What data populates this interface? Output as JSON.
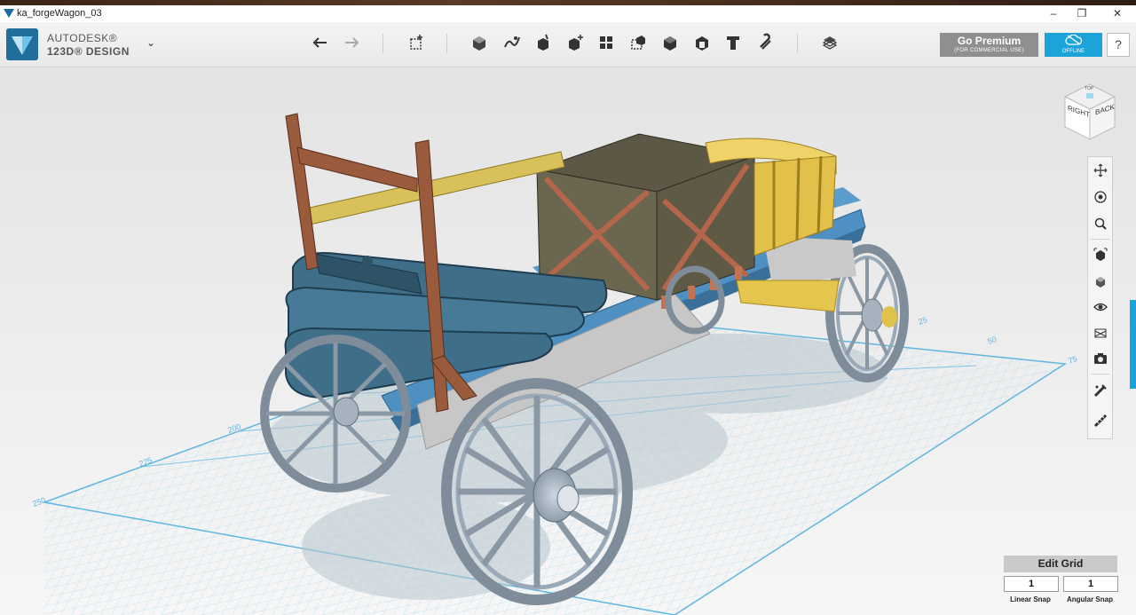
{
  "window": {
    "title": "ka_forgeWagon_03",
    "controls": [
      "minimize-icon",
      "maximize-icon",
      "close-icon"
    ]
  },
  "brand": {
    "line1": "AUTODESK®",
    "line2": "123D® DESIGN"
  },
  "toolbar": {
    "tools": [
      "undo-icon",
      "redo-icon",
      "primitives-icon",
      "sketch-icon",
      "construct-icon",
      "modify-icon",
      "pattern-icon",
      "grouping-icon",
      "combine-icon",
      "measure-icon",
      "text-icon",
      "snap-icon",
      "material-icon"
    ],
    "premium_label": "Go Premium",
    "premium_sub": "(FOR COMMERCIAL USE)",
    "offline_label": "OFFLINE",
    "help_label": "?"
  },
  "viewcube": {
    "face_right": "RIGHT",
    "face_back": "BACK",
    "face_top": "TOP"
  },
  "grid": {
    "labels": [
      "250",
      "225",
      "200",
      "25",
      "50",
      "75"
    ]
  },
  "navbar": {
    "items": [
      "pan-icon",
      "orbit-icon",
      "zoom-icon",
      "fit-icon",
      "view-icon",
      "visibility-icon",
      "material-view-icon",
      "camera-icon",
      "snap-tool-icon",
      "ruler-icon"
    ]
  },
  "edit_grid": {
    "label": "Edit Grid",
    "linear_snap_value": "1",
    "angular_snap_value": "1",
    "linear_snap_label": "Linear Snap",
    "angular_snap_label": "Angular Snap"
  },
  "colors": {
    "accent": "#1ca3d9",
    "premium": "#8f8f8f",
    "grid_line": "#7dc4e6",
    "frame_blue": "#4f90c2",
    "wood_brown": "#9a5a3c",
    "crate": "#6b6650",
    "chest": "#e2c04a"
  }
}
